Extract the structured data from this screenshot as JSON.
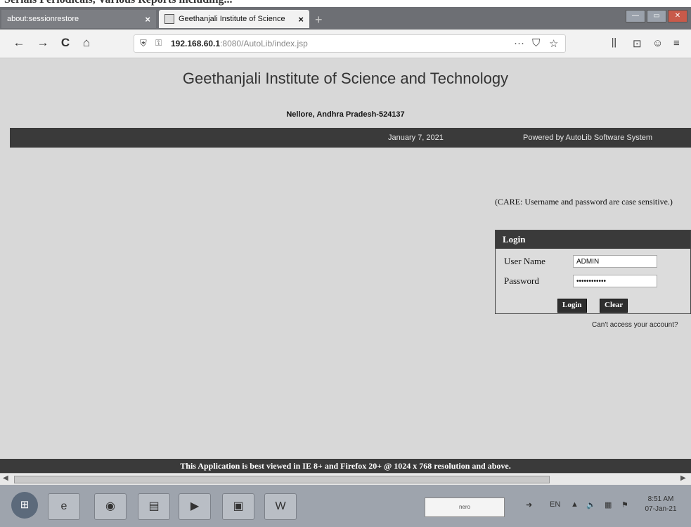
{
  "document": {
    "caption_fragment": "Serials Periodicals, Various Reports including..."
  },
  "browser": {
    "tabs": [
      {
        "label": "about:sessionrestore",
        "close": "×",
        "active": false
      },
      {
        "label": "Geethanjali Institute of Science",
        "close": "×",
        "active": true
      }
    ],
    "new_tab": "+",
    "window_controls": [
      "—",
      "▭",
      "✕"
    ],
    "nav": {
      "back": "←",
      "forward": "→",
      "reload": "C",
      "home": "⌂"
    },
    "url": {
      "host": "192.168.60.1",
      "port_path": ":8080/AutoLib/index.jsp"
    },
    "url_actions": {
      "more": "···",
      "pocket": "⛉",
      "bookmark": "☆"
    },
    "toolbar_icons": {
      "library": "⫼",
      "sidebar": "⊡",
      "account": "☺",
      "menu": "≡"
    }
  },
  "site": {
    "title": "Geethanjali Institute of Science and Technology",
    "address": "Nellore, Andhra Pradesh-524137",
    "date": "January 7, 2021",
    "powered_by": "Powered by AutoLib Software System",
    "care_note": "(CARE: Username and password are case sensitive.)",
    "login": {
      "header": "Login",
      "username_label": "User Name",
      "username_value": "ADMIN",
      "password_label": "Password",
      "password_value": "••••••••••••",
      "login_button": "Login",
      "clear_button": "Clear",
      "cant_access": "Can't access your account?"
    },
    "footer": "This Application is best viewed in IE 8+ and Firefox 20+ @ 1024 x 768 resolution and above."
  },
  "taskbar": {
    "nero_label": "nero",
    "language": "EN",
    "time": "8:51 AM",
    "date": "07-Jan-21"
  }
}
